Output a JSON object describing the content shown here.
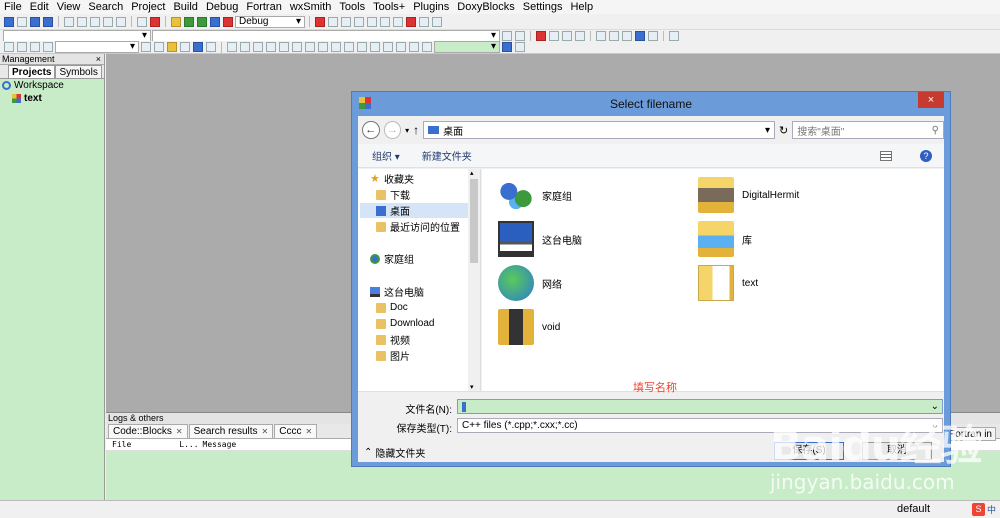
{
  "menu": [
    "File",
    "Edit",
    "View",
    "Search",
    "Project",
    "Build",
    "Debug",
    "Fortran",
    "wxSmith",
    "Tools",
    "Tools+",
    "Plugins",
    "DoxyBlocks",
    "Settings",
    "Help"
  ],
  "toolbar": {
    "build_target": "Debug"
  },
  "management": {
    "title": "Management",
    "close": "×",
    "tabs": [
      "Projects",
      "Symbols"
    ],
    "tree": {
      "workspace": "Workspace",
      "project": "text"
    }
  },
  "logs": {
    "title": "Logs & others",
    "tabs": [
      "Code::Blocks",
      "Search results",
      "Cccc"
    ],
    "right_tab": "Fortran in",
    "columns": [
      "File",
      "L...",
      "Message"
    ]
  },
  "status": {
    "mode": "default",
    "ime": "中"
  },
  "dialog": {
    "title": "Select filename",
    "close": "×",
    "address": "桌面",
    "search_placeholder": "搜索\"桌面\"",
    "commands": {
      "organize": "组织 ▾",
      "new_folder": "新建文件夹"
    },
    "nav": {
      "favorites": "收藏夹",
      "downloads": "下载",
      "desktop": "桌面",
      "recent": "最近访问的位置",
      "homegroup": "家庭组",
      "this_pc": "这台电脑",
      "doc": "Doc",
      "download": "Download",
      "videos": "视频",
      "pictures": "图片"
    },
    "items": {
      "homegroup": "家庭组",
      "digitalhermit": "DigitalHermit",
      "this_pc": "这台电脑",
      "library": "库",
      "network": "网络",
      "text": "text",
      "void": "void"
    },
    "filename_label": "文件名(N):",
    "filename_value": "",
    "filetype_label": "保存类型(T):",
    "filetype_value": "C++ files (*.cpp;*.cxx;*.cc)",
    "hint": "填写名称",
    "hide_folders": "隐藏文件夹",
    "save": "保存(S)",
    "cancel": "取消"
  },
  "watermark": {
    "logo": "Baidu经验",
    "url": "jingyan.baidu.com"
  }
}
